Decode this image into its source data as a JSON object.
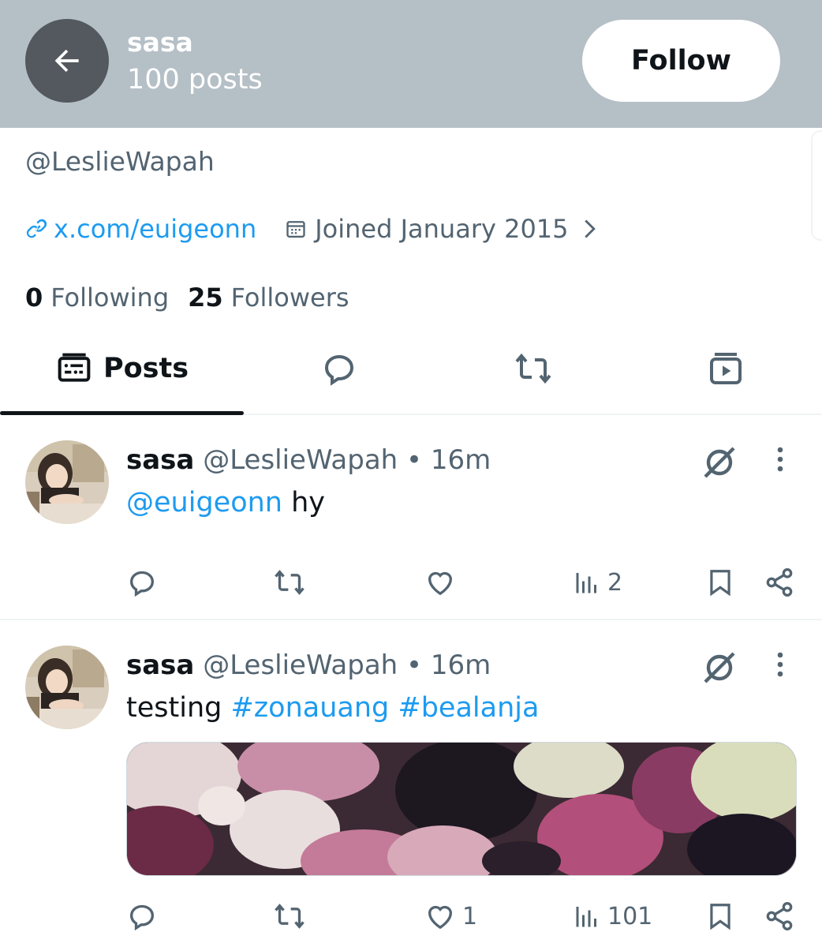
{
  "header": {
    "name": "sasa",
    "posts_count": "100 posts",
    "follow_label": "Follow"
  },
  "profile": {
    "handle": "@LeslieWapah",
    "website": "x.com/euigeonn",
    "joined": "Joined January 2015",
    "following_count": "0",
    "following_label": "Following",
    "followers_count": "25",
    "followers_label": "Followers"
  },
  "tabs": [
    {
      "label": "Posts",
      "icon": "posts-icon",
      "active": true
    },
    {
      "label": "",
      "icon": "replies-icon"
    },
    {
      "label": "",
      "icon": "reposts-icon"
    },
    {
      "label": "",
      "icon": "media-icon"
    }
  ],
  "posts": [
    {
      "name": "sasa",
      "handle": "@LeslieWapah",
      "separator": "•",
      "time": "16m",
      "mention": "@euigeonn",
      "text": " hy",
      "replies": "",
      "reposts": "",
      "likes": "",
      "views": "2"
    },
    {
      "name": "sasa",
      "handle": "@LeslieWapah",
      "separator": "•",
      "time": "16m",
      "text": "testing ",
      "tag1": "#zonauang",
      "tag2": "#bealanja",
      "replies": "",
      "reposts": "",
      "likes": "1",
      "views": "101"
    }
  ],
  "colors": {
    "header_bg": "#b5bfc6",
    "accent": "#1d9bf0",
    "text_primary": "#0f1419",
    "text_secondary": "#536471"
  }
}
